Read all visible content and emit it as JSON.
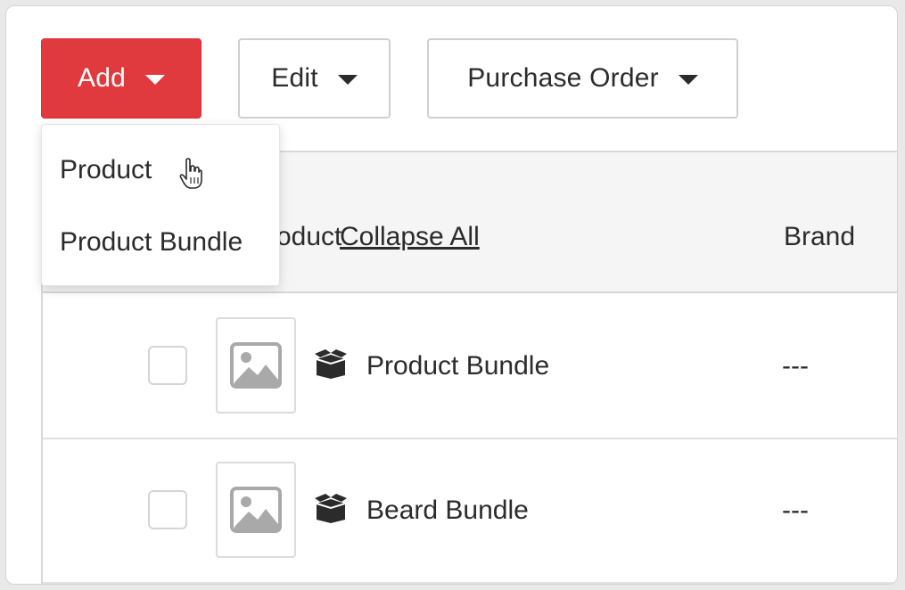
{
  "toolbar": {
    "add_label": "Add",
    "edit_label": "Edit",
    "purchase_order_label": "Purchase Order"
  },
  "add_menu": {
    "items": [
      "Product",
      "Product Bundle"
    ]
  },
  "table": {
    "columns": {
      "product": "Product",
      "collapse_all": "Collapse All",
      "brand": "Brand"
    },
    "rows": [
      {
        "name": "Product Bundle",
        "brand": "---",
        "icon": "bundle-box-icon"
      },
      {
        "name": "Beard Bundle",
        "brand": "---",
        "icon": "bundle-box-icon"
      }
    ]
  },
  "colors": {
    "accent": "#e03a3e",
    "header_bg": "#f5f5f5",
    "border": "#d9d9d9"
  }
}
